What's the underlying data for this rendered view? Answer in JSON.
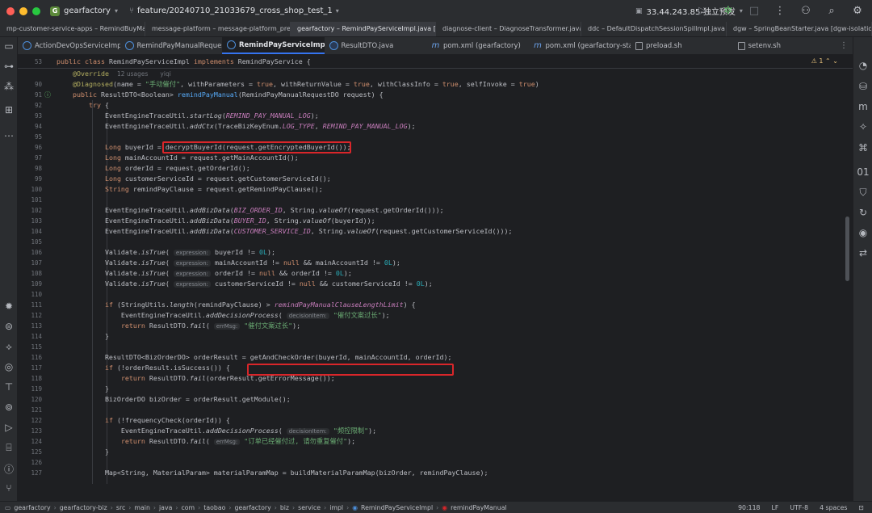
{
  "titlebar": {
    "project": "gearfactory",
    "project_initial": "G",
    "branch": "feature/20240710_21033679_cross_shop_test_1",
    "run_config": "33.44.243.85-独立预发"
  },
  "project_tabs": [
    "mp-customer-service-apps – RemindBuyMa",
    "message-platform – message-platform_prel",
    "gearfactory – RemindPayServiceImpl.java [g",
    "diagnose-client – DiagnoseTransformer.java",
    "ddc – DefaultDispatchSessionSpilImpl.java [c",
    "dgw – SpringBeanStarter.java [dgw-isolation"
  ],
  "file_tabs": [
    {
      "label": "ActionDevOpsServiceImpl.java",
      "icon": "c"
    },
    {
      "label": "RemindPayManualRequestDO.java",
      "icon": "c"
    },
    {
      "label": "RemindPayServiceImpl.java",
      "icon": "c"
    },
    {
      "label": "ResultDTO.java",
      "icon": "cb"
    },
    {
      "label": "pom.xml (gearfactory)",
      "icon": "m"
    },
    {
      "label": "pom.xml (gearfactory-start)",
      "icon": "m"
    },
    {
      "label": "preload.sh",
      "icon": "sh"
    },
    {
      "label": "setenv.sh",
      "icon": "sh"
    }
  ],
  "editor": {
    "sticky_line_number": "53",
    "warning_count": "1",
    "usages_text": "12 usages",
    "author_text": "yiqi",
    "line_numbers": [
      "90",
      "91",
      "92",
      "93",
      "94",
      "95",
      "96",
      "97",
      "98",
      "99",
      "100",
      "101",
      "102",
      "103",
      "104",
      "105",
      "106",
      "107",
      "108",
      "109",
      "110",
      "111",
      "112",
      "113",
      "114",
      "115",
      "116",
      "117",
      "118",
      "119",
      "120",
      "121",
      "122",
      "123",
      "124",
      "125",
      "126",
      "127"
    ],
    "hints": {
      "expression": "expression:",
      "decision_item": "decisionItem:",
      "err_msg": "errMsg:"
    },
    "strings": {
      "manual_remind": "\"手动催付\"",
      "clause_too_long": "\"催付文案过长\"",
      "frequency_control": "\"频控限制\"",
      "already_reminded": "\"订单已经催付过, 请勿重复催付\""
    }
  },
  "statusbar": {
    "breadcrumbs": [
      "gearfactory",
      "gearfactory-biz",
      "src",
      "main",
      "java",
      "com",
      "taobao",
      "gearfactory",
      "biz",
      "service",
      "impl",
      "RemindPayServiceImpl",
      "remindPayManual"
    ],
    "position": "90:118",
    "line_ending": "LF",
    "encoding": "UTF-8",
    "indent": "4 spaces"
  }
}
